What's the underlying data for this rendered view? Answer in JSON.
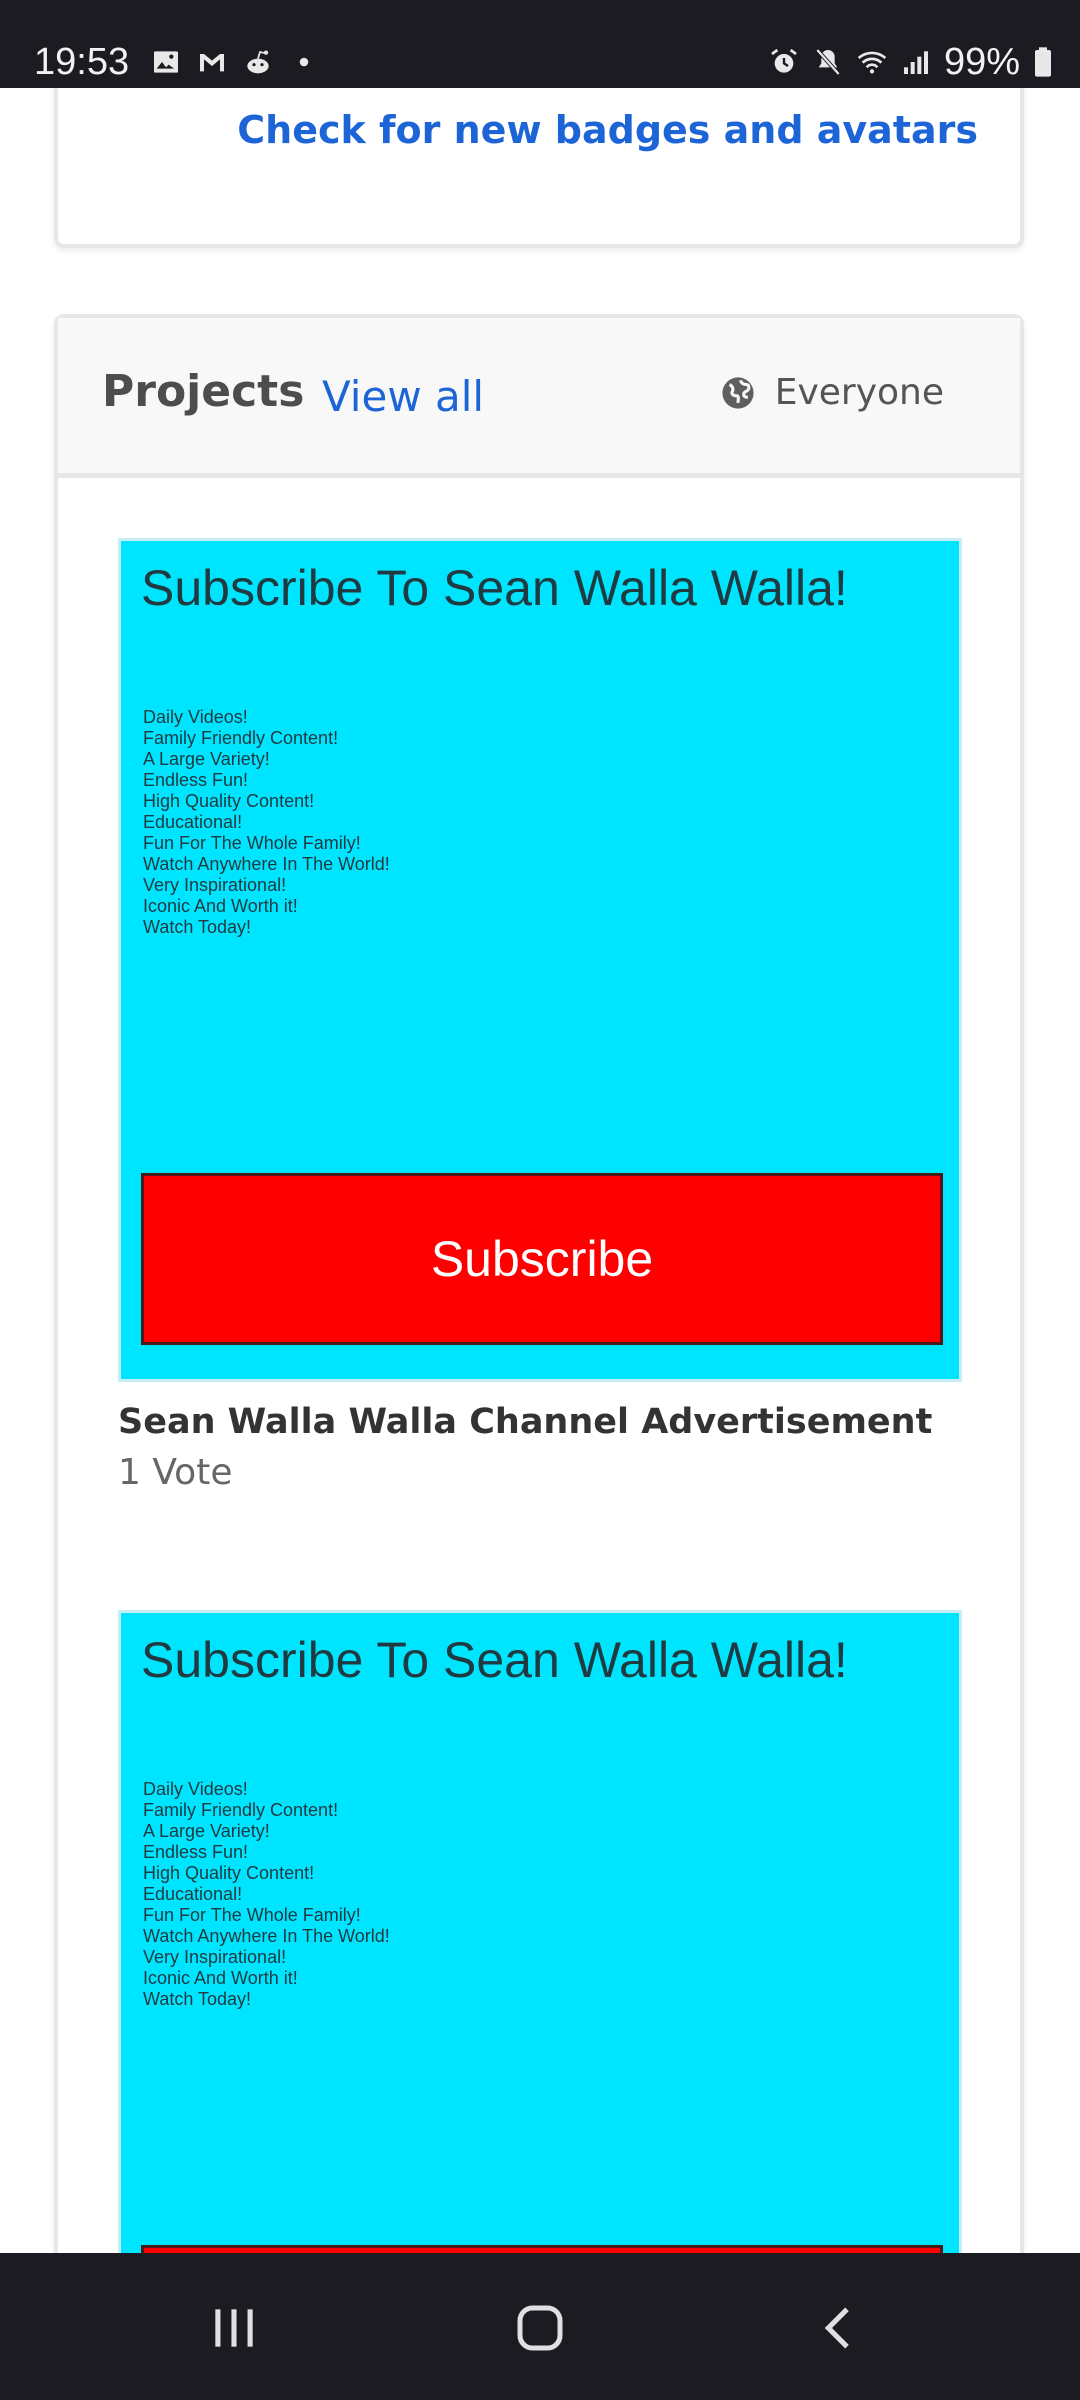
{
  "status_bar": {
    "time": "19:53",
    "battery_text": "99%",
    "left_icons": [
      "gallery-icon",
      "gmail-icon",
      "reddit-icon",
      "dot-icon"
    ],
    "right_icons": [
      "alarm-icon",
      "mute-icon",
      "wifi-icon",
      "signal-icon",
      "battery-icon"
    ]
  },
  "badges_card": {
    "link_label": "Check for new badges and avatars"
  },
  "projects": {
    "title": "Projects",
    "view_all_label": "View all",
    "visibility_label": "Everyone",
    "items": [
      {
        "thumbnail": {
          "title": "Subscribe To Sean Walla Walla!",
          "lines": [
            "Daily Videos!",
            "Family Friendly Content!",
            "A Large Variety!",
            "Endless Fun!",
            "High Quality Content!",
            "Educational!",
            "Fun For The Whole Family!",
            "Watch Anywhere In The World!",
            "Very Inspirational!",
            "Iconic And Worth it!",
            "Watch Today!"
          ],
          "button_label": "Subscribe"
        },
        "name": "Sean Walla Walla Channel Advertisement",
        "votes": "1 Vote"
      },
      {
        "thumbnail": {
          "title": "Subscribe To Sean Walla Walla!",
          "lines": [
            "Daily Videos!",
            "Family Friendly Content!",
            "A Large Variety!",
            "Endless Fun!",
            "High Quality Content!",
            "Educational!",
            "Fun For The Whole Family!",
            "Watch Anywhere In The World!",
            "Very Inspirational!",
            "Iconic And Worth it!",
            "Watch Today!"
          ]
        }
      }
    ]
  },
  "colors": {
    "accent": "#1d65d6",
    "thumbnail_bg": "#00e5ff",
    "subscribe_red": "#ff0000",
    "system_bar": "#1b1b21"
  }
}
